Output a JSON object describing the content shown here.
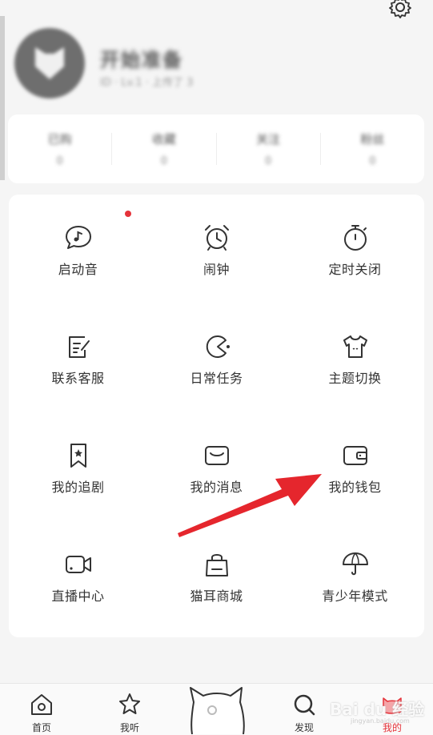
{
  "header": {
    "nickname": "开始准备",
    "subtitle": "ID  ·  Lv.1  ·  上传了 3",
    "stats": [
      {
        "title": "已购",
        "value": "0"
      },
      {
        "title": "收藏",
        "value": "0"
      },
      {
        "title": "关注",
        "value": "0"
      },
      {
        "title": "粉丝",
        "value": "0"
      }
    ]
  },
  "grid": {
    "items": [
      {
        "label": "启动音",
        "icon": "music-bubble-icon"
      },
      {
        "label": "闹钟",
        "icon": "alarm-clock-icon"
      },
      {
        "label": "定时关闭",
        "icon": "timer-icon"
      },
      {
        "label": "联系客服",
        "icon": "edit-note-icon"
      },
      {
        "label": "日常任务",
        "icon": "pacman-icon"
      },
      {
        "label": "主题切换",
        "icon": "tshirt-icon"
      },
      {
        "label": "我的追剧",
        "icon": "bookmark-icon"
      },
      {
        "label": "我的消息",
        "icon": "envelope-icon"
      },
      {
        "label": "我的钱包",
        "icon": "wallet-icon"
      },
      {
        "label": "直播中心",
        "icon": "video-camera-icon"
      },
      {
        "label": "猫耳商城",
        "icon": "shopping-bag-icon"
      },
      {
        "label": "青少年模式",
        "icon": "umbrella-icon"
      }
    ]
  },
  "nav": {
    "home": "首页",
    "listen": "我听",
    "discover": "发现",
    "mine": "我的"
  },
  "watermark": {
    "brand": "Bai du 经验",
    "url": "jingyan.baidu.com"
  },
  "colors": {
    "accent": "#e5333a",
    "card": "#ffffff",
    "background": "#f5f5f5"
  }
}
